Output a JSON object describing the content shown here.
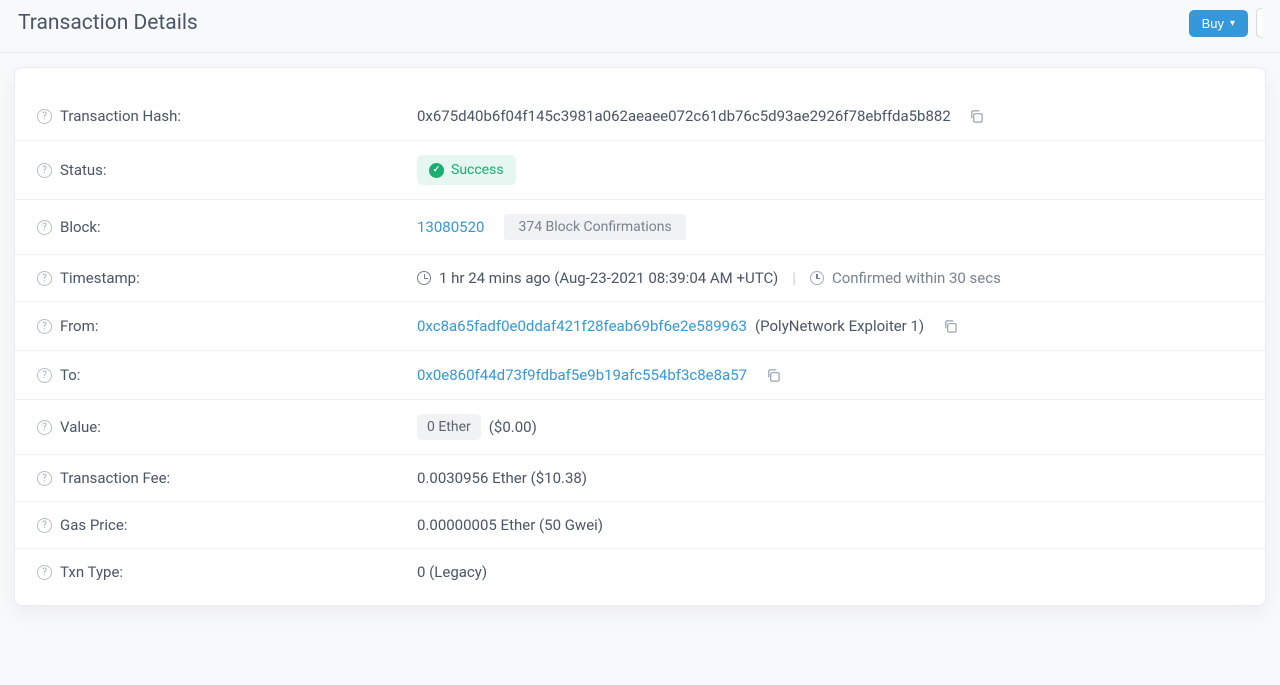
{
  "header": {
    "title": "Transaction Details",
    "buy_label": "Buy"
  },
  "labels": {
    "tx_hash": "Transaction Hash:",
    "status": "Status:",
    "block": "Block:",
    "timestamp": "Timestamp:",
    "from": "From:",
    "to": "To:",
    "value": "Value:",
    "tx_fee": "Transaction Fee:",
    "gas_price": "Gas Price:",
    "txn_type": "Txn Type:"
  },
  "values": {
    "tx_hash": "0x675d40b6f04f145c3981a062aeaee072c61db76c5d93ae2926f78ebffda5b882",
    "status_text": "Success",
    "block_number": "13080520",
    "block_confirmations": "374 Block Confirmations",
    "timestamp_ago": "1 hr 24 mins ago (Aug-23-2021 08:39:04 AM +UTC)",
    "timestamp_confirmed": "Confirmed within 30 secs",
    "from_address": "0xc8a65fadf0e0ddaf421f28feab69bf6e2e589963",
    "from_label": "(PolyNetwork Exploiter 1)",
    "to_address": "0x0e860f44d73f9fdbaf5e9b19afc554bf3c8e8a57",
    "value_amount": "0 Ether",
    "value_usd": "($0.00)",
    "tx_fee": "0.0030956 Ether ($10.38)",
    "gas_price": "0.00000005 Ether (50 Gwei)",
    "txn_type": "0 (Legacy)"
  }
}
